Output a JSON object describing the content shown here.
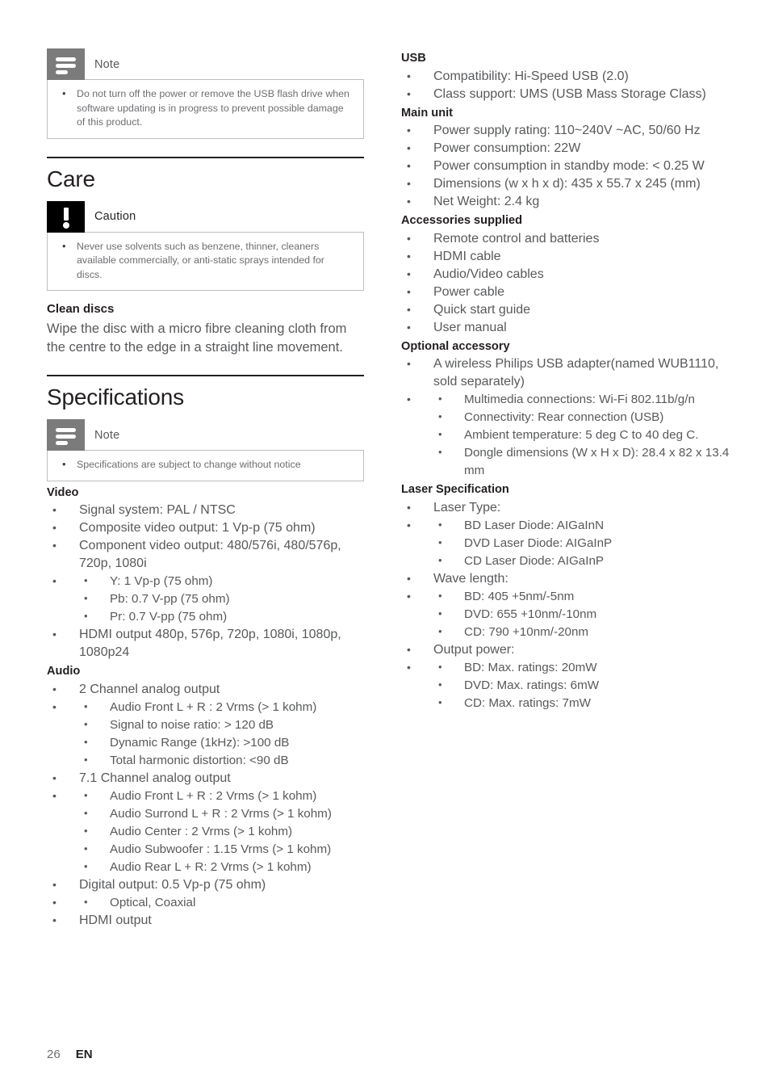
{
  "document": {
    "footer": {
      "page_number": "26",
      "language": "EN"
    }
  },
  "left_column": {
    "note_top": {
      "icon": "note-lines-icon",
      "title": "Note",
      "items": [
        "Do not turn off the power or remove the USB flash drive when software updating is in progress to prevent possible damage of this product."
      ]
    },
    "care_chapter": {
      "title": "Care"
    },
    "caution": {
      "icon": "exclamation-icon",
      "title": "Caution",
      "items": [
        "Never use solvents such as benzene, thinner, cleaners available commercially, or anti-static sprays intended for discs."
      ]
    },
    "clean_discs": {
      "heading": "Clean discs",
      "paragraph": "Wipe the disc with a micro fibre cleaning cloth from the centre to the edge in a straight line movement."
    },
    "specifications_chapter": {
      "title": "Specifications"
    },
    "note_specs": {
      "icon": "note-lines-icon",
      "title": "Note",
      "items": [
        "Specifications are subject to change without notice"
      ]
    },
    "video": {
      "heading": "Video",
      "items": [
        {
          "text": "Signal system: PAL / NTSC",
          "sub": []
        },
        {
          "text": "Composite video output: 1 Vp-p (75 ohm)",
          "sub": []
        },
        {
          "text": "Component video output: 480/576i, 480/576p, 720p, 1080i",
          "sub": [
            "Y: 1 Vp-p (75 ohm)",
            "Pb: 0.7 V-pp (75 ohm)",
            "Pr: 0.7 V-pp (75 ohm)"
          ]
        },
        {
          "text": "HDMI output 480p, 576p, 720p, 1080i, 1080p, 1080p24",
          "sub": []
        }
      ]
    },
    "audio": {
      "heading": "Audio",
      "items": [
        {
          "text": "2 Channel analog output",
          "sub": [
            "Audio Front L + R : 2 Vrms (> 1 kohm)",
            "Signal to noise ratio: > 120 dB",
            "Dynamic Range (1kHz): >100 dB",
            "Total harmonic distortion: <90 dB"
          ]
        },
        {
          "text": "7.1 Channel analog output",
          "sub": [
            "Audio Front L + R : 2 Vrms (> 1 kohm)",
            "Audio Surrond L + R : 2 Vrms (> 1 kohm)",
            "Audio Center : 2 Vrms (> 1 kohm)",
            "Audio Subwoofer : 1.15 Vrms (> 1 kohm)",
            "Audio Rear L + R: 2 Vrms (> 1 kohm)"
          ]
        },
        {
          "text": "Digital output: 0.5 Vp-p (75 ohm)",
          "sub": [
            "Optical, Coaxial"
          ]
        },
        {
          "text": "HDMI output",
          "sub": []
        }
      ]
    }
  },
  "right_column": {
    "usb": {
      "heading": "USB",
      "items": [
        {
          "text": "Compatibility: Hi-Speed USB (2.0)",
          "sub": []
        },
        {
          "text": "Class support: UMS (USB Mass Storage Class)",
          "sub": []
        }
      ]
    },
    "main_unit": {
      "heading": "Main unit",
      "items": [
        {
          "text": "Power supply rating: 110~240V ~AC, 50/60 Hz",
          "sub": []
        },
        {
          "text": "Power consumption: 22W",
          "sub": []
        },
        {
          "text": "Power consumption in standby mode: < 0.25 W",
          "sub": []
        },
        {
          "text": "Dimensions (w x h x d): 435 x 55.7 x 245 (mm)",
          "sub": []
        },
        {
          "text": "Net Weight: 2.4 kg",
          "sub": []
        }
      ]
    },
    "accessories": {
      "heading": "Accessories supplied",
      "items": [
        {
          "text": "Remote control and batteries",
          "sub": []
        },
        {
          "text": "HDMI cable",
          "sub": []
        },
        {
          "text": "Audio/Video cables",
          "sub": []
        },
        {
          "text": "Power cable",
          "sub": []
        },
        {
          "text": "Quick start guide",
          "sub": []
        },
        {
          "text": "User manual",
          "sub": []
        }
      ]
    },
    "optional_accessory": {
      "heading": "Optional accessory",
      "items": [
        {
          "text": "A wireless Philips USB adapter(named WUB1110, sold separately)",
          "sub": [
            "Multimedia connections: Wi-Fi 802.11b/g/n",
            "Connectivity: Rear connection (USB)",
            "Ambient temperature: 5 deg C to 40 deg C.",
            "Dongle dimensions (W x H x D): 28.4 x 82 x 13.4 mm"
          ]
        }
      ]
    },
    "laser_specification": {
      "heading": "Laser Specification",
      "items": [
        {
          "text": "Laser Type:",
          "sub": [
            "BD Laser Diode: AIGaInN",
            "DVD Laser Diode: AIGaInP",
            "CD Laser Diode: AIGaInP"
          ]
        },
        {
          "text": "Wave length:",
          "sub": [
            "BD: 405 +5nm/-5nm",
            "DVD: 655 +10nm/-10nm",
            "CD: 790 +10nm/-20nm"
          ]
        },
        {
          "text": "Output power:",
          "sub": [
            "BD: Max. ratings: 20mW",
            "DVD: Max. ratings: 6mW",
            "CD: Max. ratings: 7mW"
          ]
        }
      ]
    }
  }
}
